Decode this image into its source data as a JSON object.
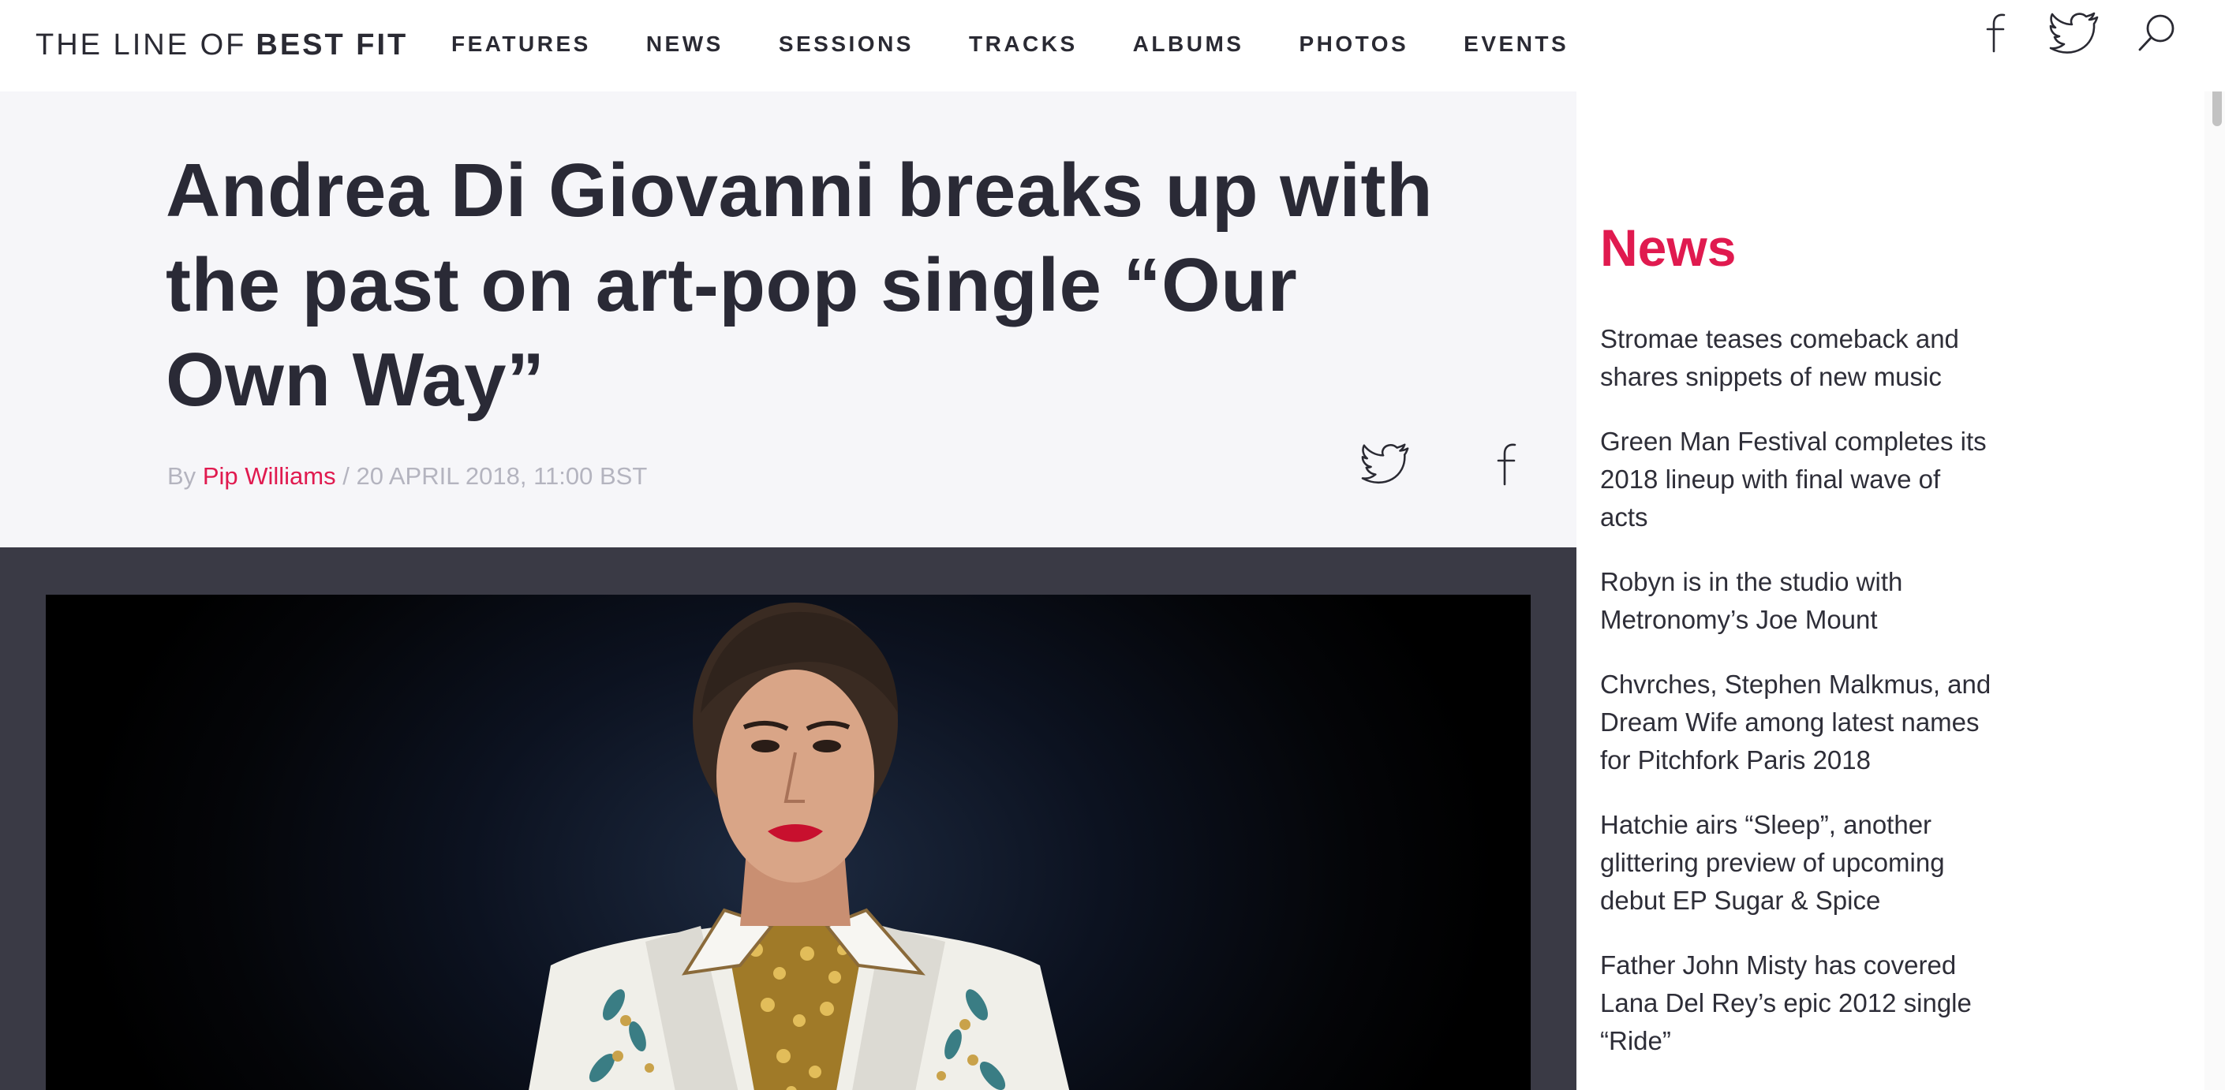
{
  "header": {
    "brand_light": "THE LINE OF",
    "brand_bold": "BEST FIT",
    "nav": [
      "FEATURES",
      "NEWS",
      "SESSIONS",
      "TRACKS",
      "ALBUMS",
      "PHOTOS",
      "EVENTS"
    ],
    "icons": [
      "facebook-icon",
      "twitter-icon",
      "search-icon"
    ]
  },
  "article": {
    "title": "Andrea Di Giovanni breaks up with the past on art-pop single “Our Own Way”",
    "by_label": "By",
    "author": "Pip Williams",
    "separator": "/",
    "date": "20 APRIL 2018, 11:00 BST",
    "share_icons": [
      "twitter-icon",
      "facebook-icon"
    ]
  },
  "sidebar": {
    "heading": "News",
    "items": [
      "Stromae teases comeback and shares snippets of new music",
      "Green Man Festival completes its 2018 lineup with final wave of acts",
      "Robyn is in the studio with Metronomy’s Joe Mount",
      "Chvrches, Stephen Malkmus, and Dream Wife among latest names for Pitchfork Paris 2018",
      "Hatchie airs “Sleep”, another glittering preview of upcoming debut EP Sugar & Spice",
      "Father John Misty has covered Lana Del Rey’s epic 2012 single “Ride”"
    ]
  },
  "colors": {
    "accent": "#e01a4f",
    "text": "#2a2a33",
    "hero_bg": "#f6f6f9",
    "media_bg": "#3a3a45"
  }
}
